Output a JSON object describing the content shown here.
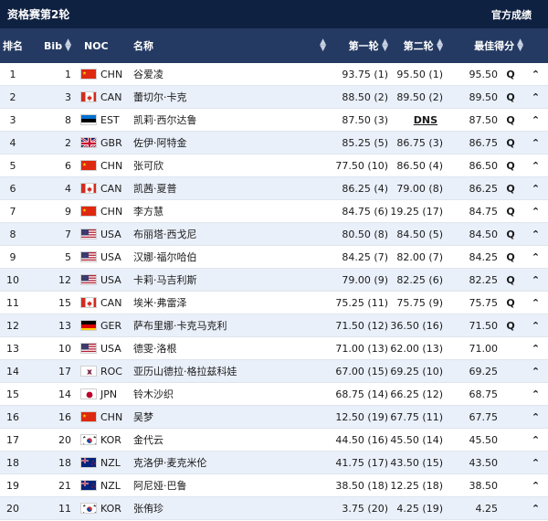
{
  "topbar": {
    "title": "资格赛第2轮",
    "official": "官方成绩"
  },
  "header": {
    "rank": "排名",
    "bib": "Bib",
    "noc": "NOC",
    "name": "名称",
    "r1": "第一轮",
    "r2": "第二轮",
    "best": "最佳得分"
  },
  "icons": {
    "sort": "sort-icon",
    "expand": "chevron-up-icon"
  },
  "colors": {
    "topbar": "#0f2141",
    "header": "#243a63",
    "alt_row": "#eaf0fa"
  },
  "rows": [
    {
      "rank": "1",
      "bib": "1",
      "noc": "CHN",
      "flag": "chn",
      "name": "谷爱凌",
      "r1": "93.75 (1)",
      "r2": "95.50 (1)",
      "best": "95.50",
      "q": "Q"
    },
    {
      "rank": "2",
      "bib": "3",
      "noc": "CAN",
      "flag": "can",
      "name": "蕾切尔·卡克",
      "r1": "88.50 (2)",
      "r2": "89.50 (2)",
      "best": "89.50",
      "q": "Q"
    },
    {
      "rank": "3",
      "bib": "8",
      "noc": "EST",
      "flag": "est",
      "name": "凯莉·西尔达鲁",
      "r1": "87.50 (3)",
      "r2": "DNS",
      "best": "87.50",
      "q": "Q"
    },
    {
      "rank": "4",
      "bib": "2",
      "noc": "GBR",
      "flag": "gbr",
      "name": "佐伊·阿特金",
      "r1": "85.25 (5)",
      "r2": "86.75 (3)",
      "best": "86.75",
      "q": "Q"
    },
    {
      "rank": "5",
      "bib": "6",
      "noc": "CHN",
      "flag": "chn",
      "name": "张可欣",
      "r1": "77.50 (10)",
      "r2": "86.50 (4)",
      "best": "86.50",
      "q": "Q"
    },
    {
      "rank": "6",
      "bib": "4",
      "noc": "CAN",
      "flag": "can",
      "name": "凯茜·夏普",
      "r1": "86.25 (4)",
      "r2": "79.00 (8)",
      "best": "86.25",
      "q": "Q"
    },
    {
      "rank": "7",
      "bib": "9",
      "noc": "CHN",
      "flag": "chn",
      "name": "李方慧",
      "r1": "84.75 (6)",
      "r2": "19.25 (17)",
      "best": "84.75",
      "q": "Q"
    },
    {
      "rank": "8",
      "bib": "7",
      "noc": "USA",
      "flag": "usa",
      "name": "布丽塔·西戈尼",
      "r1": "80.50 (8)",
      "r2": "84.50 (5)",
      "best": "84.50",
      "q": "Q"
    },
    {
      "rank": "9",
      "bib": "5",
      "noc": "USA",
      "flag": "usa",
      "name": "汉娜·福尔哈伯",
      "r1": "84.25 (7)",
      "r2": "82.00 (7)",
      "best": "84.25",
      "q": "Q"
    },
    {
      "rank": "10",
      "bib": "12",
      "noc": "USA",
      "flag": "usa",
      "name": "卡莉·马吉利斯",
      "r1": "79.00 (9)",
      "r2": "82.25 (6)",
      "best": "82.25",
      "q": "Q"
    },
    {
      "rank": "11",
      "bib": "15",
      "noc": "CAN",
      "flag": "can",
      "name": "埃米·弗雷泽",
      "r1": "75.25 (11)",
      "r2": "75.75 (9)",
      "best": "75.75",
      "q": "Q"
    },
    {
      "rank": "12",
      "bib": "13",
      "noc": "GER",
      "flag": "ger",
      "name": "萨布里娜·卡克马克利",
      "r1": "71.50 (12)",
      "r2": "36.50 (16)",
      "best": "71.50",
      "q": "Q"
    },
    {
      "rank": "13",
      "bib": "10",
      "noc": "USA",
      "flag": "usa",
      "name": "德雯·洛根",
      "r1": "71.00 (13)",
      "r2": "62.00 (13)",
      "best": "71.00",
      "q": ""
    },
    {
      "rank": "14",
      "bib": "17",
      "noc": "ROC",
      "flag": "roc",
      "name": "亚历山德拉·格拉兹科娃",
      "r1": "67.00 (15)",
      "r2": "69.25 (10)",
      "best": "69.25",
      "q": ""
    },
    {
      "rank": "15",
      "bib": "14",
      "noc": "JPN",
      "flag": "jpn",
      "name": "铃木沙织",
      "r1": "68.75 (14)",
      "r2": "66.25 (12)",
      "best": "68.75",
      "q": ""
    },
    {
      "rank": "16",
      "bib": "16",
      "noc": "CHN",
      "flag": "chn",
      "name": "吴梦",
      "r1": "12.50 (19)",
      "r2": "67.75 (11)",
      "best": "67.75",
      "q": ""
    },
    {
      "rank": "17",
      "bib": "20",
      "noc": "KOR",
      "flag": "kor",
      "name": "金代云",
      "r1": "44.50 (16)",
      "r2": "45.50 (14)",
      "best": "45.50",
      "q": ""
    },
    {
      "rank": "18",
      "bib": "18",
      "noc": "NZL",
      "flag": "nzl",
      "name": "克洛伊·麦克米伦",
      "r1": "41.75 (17)",
      "r2": "43.50 (15)",
      "best": "43.50",
      "q": ""
    },
    {
      "rank": "19",
      "bib": "21",
      "noc": "NZL",
      "flag": "nzl",
      "name": "阿尼娅·巴鲁",
      "r1": "38.50 (18)",
      "r2": "12.25 (18)",
      "best": "38.50",
      "q": ""
    },
    {
      "rank": "20",
      "bib": "11",
      "noc": "KOR",
      "flag": "kor",
      "name": "张侑珍",
      "r1": "3.75 (20)",
      "r2": "4.25 (19)",
      "best": "4.25",
      "q": ""
    }
  ]
}
